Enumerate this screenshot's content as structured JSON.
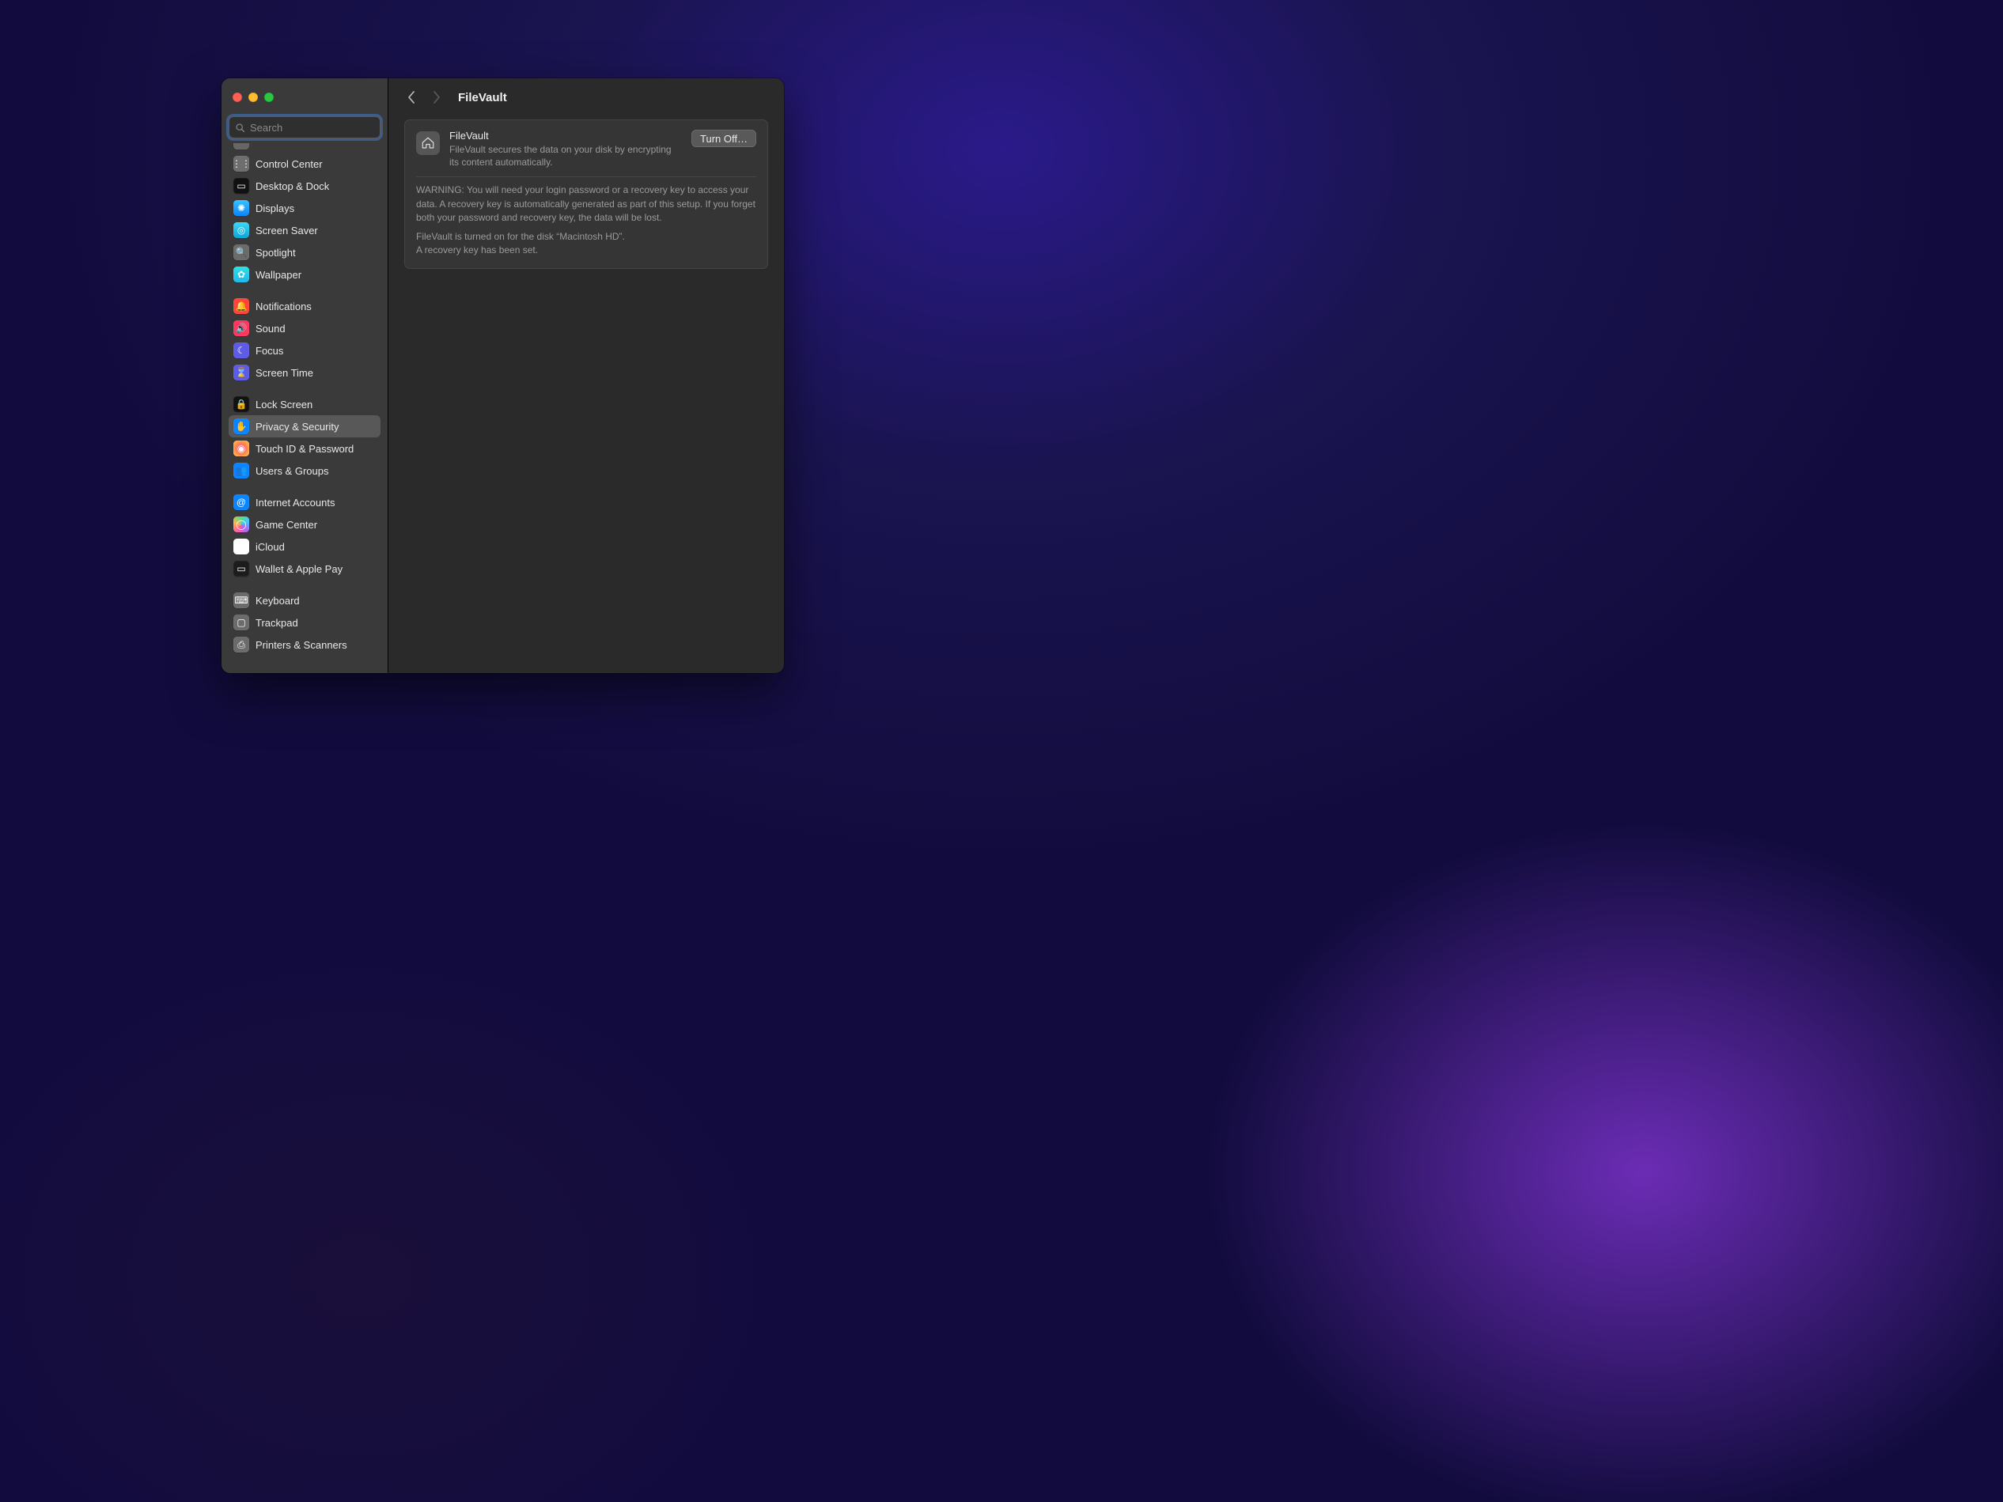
{
  "search": {
    "placeholder": "Search",
    "value": ""
  },
  "header": {
    "title": "FileVault"
  },
  "sidebar": {
    "groups": [
      [
        {
          "label": "",
          "icon": "ic-generic",
          "clippedTop": true
        },
        {
          "label": "Control Center",
          "icon": "ic-generic"
        },
        {
          "label": "Desktop & Dock",
          "icon": "ic-black"
        },
        {
          "label": "Displays",
          "icon": "ic-displays"
        },
        {
          "label": "Screen Saver",
          "icon": "ic-saver"
        },
        {
          "label": "Spotlight",
          "icon": "ic-spotlight"
        },
        {
          "label": "Wallpaper",
          "icon": "ic-wallpaper"
        }
      ],
      [
        {
          "label": "Notifications",
          "icon": "ic-notif"
        },
        {
          "label": "Sound",
          "icon": "ic-sound"
        },
        {
          "label": "Focus",
          "icon": "ic-focus"
        },
        {
          "label": "Screen Time",
          "icon": "ic-screentime"
        }
      ],
      [
        {
          "label": "Lock Screen",
          "icon": "ic-lock"
        },
        {
          "label": "Privacy & Security",
          "icon": "ic-privacy",
          "selected": true
        },
        {
          "label": "Touch ID & Password",
          "icon": "ic-touchid"
        },
        {
          "label": "Users & Groups",
          "icon": "ic-users"
        }
      ],
      [
        {
          "label": "Internet Accounts",
          "icon": "ic-internet"
        },
        {
          "label": "Game Center",
          "icon": "ic-gamectr"
        },
        {
          "label": "iCloud",
          "icon": "ic-icloud"
        },
        {
          "label": "Wallet & Apple Pay",
          "icon": "ic-wallet"
        }
      ],
      [
        {
          "label": "Keyboard",
          "icon": "ic-keyboard"
        },
        {
          "label": "Trackpad",
          "icon": "ic-trackpad"
        },
        {
          "label": "Printers & Scanners",
          "icon": "ic-printers"
        }
      ]
    ]
  },
  "panel": {
    "title": "FileVault",
    "subtitle": "FileVault secures the data on your disk by encrypting its content automatically.",
    "action": "Turn Off…",
    "warning": "WARNING: You will need your login password or a recovery key to access your data. A recovery key is automatically generated as part of this setup. If you forget both your password and recovery key, the data will be lost.",
    "status1": "FileVault is turned on for the disk “Macintosh HD”.",
    "status2": "A recovery key has been set."
  },
  "icons": {
    "control-center": "⋮⋮",
    "desktop-dock": "▭",
    "displays": "✺",
    "screen-saver": "◎",
    "spotlight": "🔍",
    "wallpaper": "✿",
    "notifications": "🔔",
    "sound": "🔊",
    "focus": "☾",
    "screen-time": "⌛",
    "lock-screen": "🔒",
    "privacy-security": "✋",
    "touch-id-password": "◉",
    "users-groups": "👥",
    "internet-accounts": "@",
    "game-center": "◯",
    "icloud": "☁︎",
    "wallet-apple-pay": "▭",
    "keyboard": "⌨",
    "trackpad": "▢",
    "printers-scanners": "⎙"
  }
}
